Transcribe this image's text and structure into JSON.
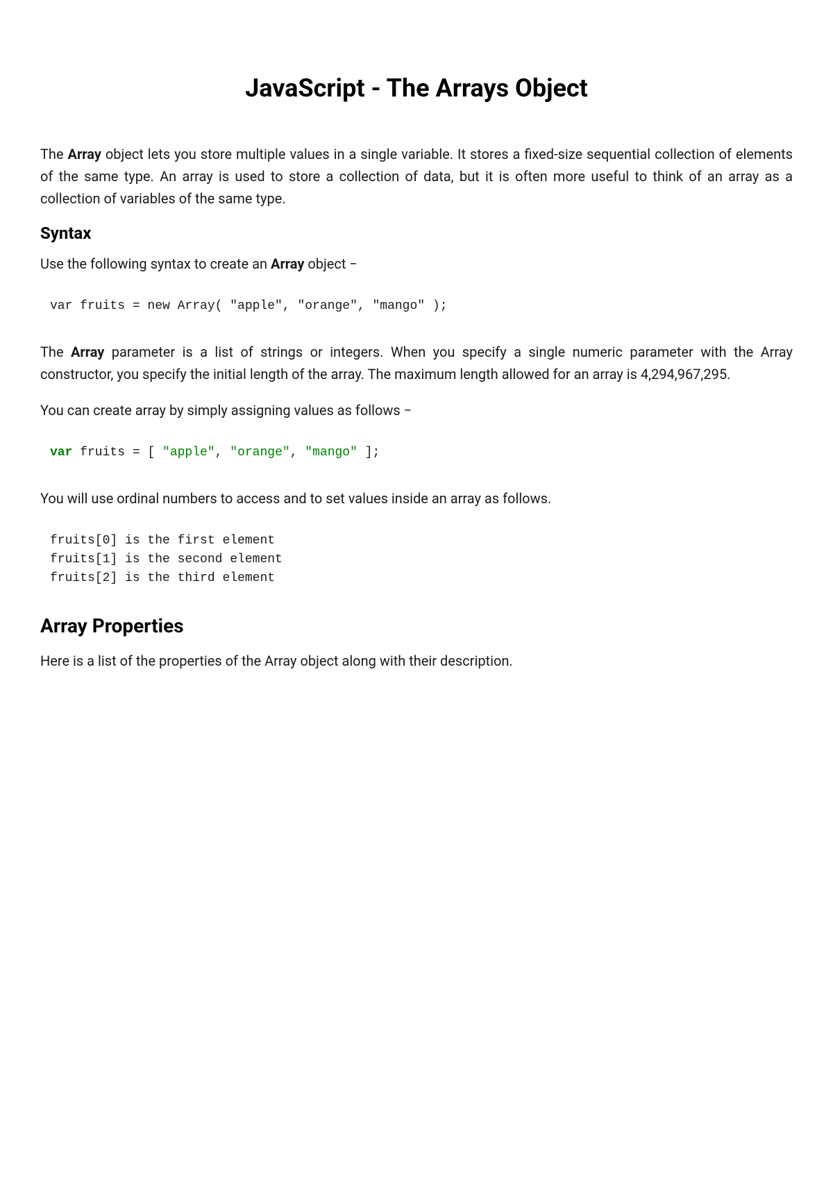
{
  "title": "JavaScript - The Arrays Object",
  "intro": {
    "prefix": "The ",
    "bold": "Array",
    "suffix": " object lets you store multiple values in a single variable. It stores a fixed-size sequential collection of elements of the same type. An array is used to store a collection of data, but it is often more useful to think of an array as a collection of variables of the same type."
  },
  "syntax": {
    "heading": "Syntax",
    "intro_prefix": "Use the following syntax to create an ",
    "intro_bold": "Array",
    "intro_suffix": " object −",
    "code1": "var fruits = new Array( \"apple\", \"orange\", \"mango\" );",
    "para2_prefix": "The ",
    "para2_bold": "Array",
    "para2_suffix": " parameter is a list of strings or integers. When you specify a single numeric parameter with the Array constructor, you specify the initial length of the array. The maximum length allowed for an array is 4,294,967,295.",
    "para3": "You can create array by simply assigning values as follows −",
    "code2_kw": "var",
    "code2_mid": " fruits = [ ",
    "code2_s1": "\"apple\"",
    "code2_c1": ", ",
    "code2_s2": "\"orange\"",
    "code2_c2": ", ",
    "code2_s3": "\"mango\"",
    "code2_end": " ];",
    "para4": "You will use ordinal numbers to access and to set values inside an array as follows.",
    "code3": "fruits[0] is the first element\nfruits[1] is the second element\nfruits[2] is the third element"
  },
  "properties": {
    "heading": "Array Properties",
    "intro": "Here is a list of the properties of the Array object along with their description."
  }
}
